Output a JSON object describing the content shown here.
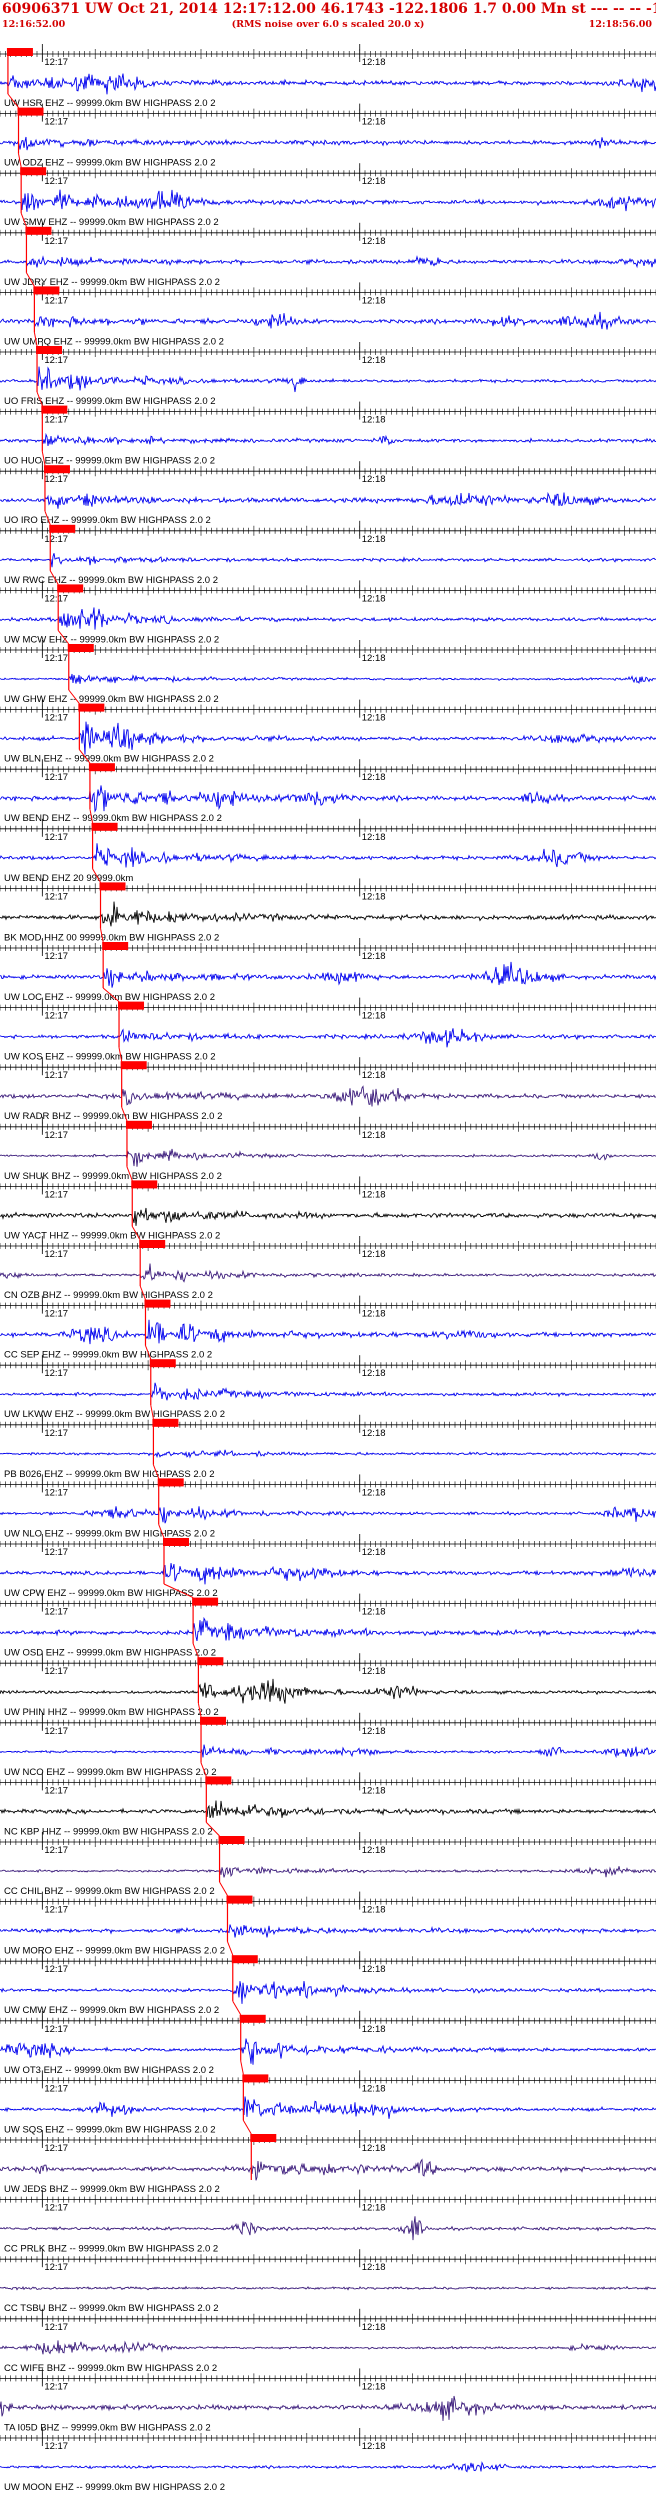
{
  "header": {
    "title": "60906371 UW Oct 21, 2014 12:17:12.00   46.1743 -122.1806  1.7 0.00 Mn st --- -- -- -1",
    "start_time": "12:16:52.00",
    "note": "(RMS noise over 6.0 s scaled 20.0 x)",
    "end_time": "12:18:56.00",
    "color": "#d40000"
  },
  "colors": {
    "blue": "#0000ee",
    "black": "#000000",
    "purple": "#3a1a7a",
    "pick": "#ff0000"
  },
  "chart_data": {
    "type": "line",
    "title": "60906371 UW Oct 21, 2014 12:17:12.00   46.1743 -122.1806  1.7 0.00 Mn st --- -- -- -1",
    "x_range": [
      "12:16:52.00",
      "12:18:56.00"
    ],
    "x_tick_labels": [
      "12:17",
      "12:18"
    ],
    "series": [
      {
        "name": "UW HSR EHZ -- 99999.0km BW  HIGHPASS  2.0  2",
        "color": "blue",
        "pick": "12:16:53.5"
      },
      {
        "name": "UW ODZ EHZ -- 99999.0km BW  HIGHPASS  2.0  2",
        "color": "blue",
        "pick": "12:16:55.5"
      },
      {
        "name": "UW SMW EHZ -- 99999.0km BW  HIGHPASS  2.0  2",
        "color": "blue",
        "pick": "12:16:56.0"
      },
      {
        "name": "UW JDRY EHZ -- 99999.0km BW  HIGHPASS  2.0  2",
        "color": "blue",
        "pick": "12:16:57.0"
      },
      {
        "name": "UW UMPQ EHZ -- 99999.0km BW  HIGHPASS  2.0  2",
        "color": "blue",
        "pick": "12:16:58.5"
      },
      {
        "name": "UO FRIS EHZ -- 99999.0km BW  HIGHPASS  2.0  2",
        "color": "blue",
        "pick": "12:16:59.0"
      },
      {
        "name": "UO HUO EHZ -- 99999.0km BW  HIGHPASS  2.0  2",
        "color": "blue",
        "pick": "12:17:00.0"
      },
      {
        "name": "UO IRO EHZ -- 99999.0km BW  HIGHPASS  2.0  2",
        "color": "blue",
        "pick": "12:17:00.5"
      },
      {
        "name": "UW RWC EHZ -- 99999.0km BW  HIGHPASS  2.0  2",
        "color": "blue",
        "pick": "12:17:01.5"
      },
      {
        "name": "UW MCW EHZ -- 99999.0km BW  HIGHPASS  2.0  2",
        "color": "blue",
        "pick": "12:17:03.0"
      },
      {
        "name": "UW GHW EHZ -- 99999.0km BW  HIGHPASS  2.0  2",
        "color": "blue",
        "pick": "12:17:05.0"
      },
      {
        "name": "UW BLN EHZ -- 99999.0km BW  HIGHPASS  2.0  2",
        "color": "blue",
        "pick": "12:17:07.0"
      },
      {
        "name": "UW BEND EHZ -- 99999.0km BW  HIGHPASS  2.0  2",
        "color": "blue",
        "pick": "12:17:09.0"
      },
      {
        "name": "UW BEND EHZ 20 99999.0km",
        "color": "blue",
        "pick": "12:17:09.5"
      },
      {
        "name": "BK MOD HHZ 00 99999.0km BW  HIGHPASS  2.0  2",
        "color": "black",
        "pick": "12:17:11.0"
      },
      {
        "name": "UW LOC EHZ -- 99999.0km BW  HIGHPASS  2.0  2",
        "color": "blue",
        "pick": "12:17:11.5"
      },
      {
        "name": "UW KOS EHZ -- 99999.0km BW  HIGHPASS  2.0  2",
        "color": "blue",
        "pick": "12:17:14.5"
      },
      {
        "name": "UW RADR BHZ -- 99999.0km BW  HIGHPASS  2.0  2",
        "color": "purple",
        "pick": "12:17:15.0"
      },
      {
        "name": "UW SHUK BHZ -- 99999.0km BW  HIGHPASS  2.0  2",
        "color": "purple",
        "pick": "12:17:16.0"
      },
      {
        "name": "UW YACT HHZ -- 99999.0km BW  HIGHPASS  2.0  2",
        "color": "black",
        "pick": "12:17:17.0"
      },
      {
        "name": "CN OZB BHZ -- 99999.0km BW  HIGHPASS  2.0  2",
        "color": "purple",
        "pick": "12:17:18.5"
      },
      {
        "name": "CC SEP EHZ -- 99999.0km BW  HIGHPASS  2.0  2",
        "color": "blue",
        "pick": "12:17:19.5"
      },
      {
        "name": "UW LKWW EHZ -- 99999.0km BW  HIGHPASS  2.0  2",
        "color": "blue",
        "pick": "12:17:20.5"
      },
      {
        "name": "PB B026 EHZ -- 99999.0km BW  HIGHPASS  2.0  2",
        "color": "blue",
        "pick": "12:17:21.0"
      },
      {
        "name": "UW NLO EHZ -- 99999.0km BW  HIGHPASS  2.0  2",
        "color": "blue",
        "pick": "12:17:22.0"
      },
      {
        "name": "UW CPW EHZ -- 99999.0km BW  HIGHPASS  2.0  2",
        "color": "blue",
        "pick": "12:17:23.0"
      },
      {
        "name": "UW OSD EHZ -- 99999.0km BW  HIGHPASS  2.0  2",
        "color": "blue",
        "pick": "12:17:28.5"
      },
      {
        "name": "UW PHIN HHZ -- 99999.0km BW  HIGHPASS  2.0  2",
        "color": "black",
        "pick": "12:17:29.5"
      },
      {
        "name": "UW NCO EHZ -- 99999.0km BW  HIGHPASS  2.0  2",
        "color": "blue",
        "pick": "12:17:30.0"
      },
      {
        "name": "NC KBP HHZ -- 99999.0km BW  HIGHPASS  2.0  2",
        "color": "black",
        "pick": "12:17:31.0"
      },
      {
        "name": "CC CHIL BHZ -- 99999.0km BW  HIGHPASS  2.0  2",
        "color": "purple",
        "pick": "12:17:33.5"
      },
      {
        "name": "UW MORO EHZ -- 99999.0km BW  HIGHPASS  2.0  2",
        "color": "blue",
        "pick": "12:17:35.0"
      },
      {
        "name": "UW CMW EHZ -- 99999.0km BW  HIGHPASS  2.0  2",
        "color": "blue",
        "pick": "12:17:36.0"
      },
      {
        "name": "UW OT3 EHZ -- 99999.0km BW  HIGHPASS  2.0  2",
        "color": "blue",
        "pick": "12:17:37.5"
      },
      {
        "name": "UW SQS EHZ -- 99999.0km BW  HIGHPASS  2.0  2",
        "color": "blue",
        "pick": "12:17:38.0"
      },
      {
        "name": "UW JEDS BHZ -- 99999.0km BW  HIGHPASS  2.0  2",
        "color": "purple",
        "pick": "12:17:39.5"
      },
      {
        "name": "CC PRLK BHZ -- 99999.0km BW  HIGHPASS  2.0  2",
        "color": "purple",
        "pick": null
      },
      {
        "name": "CC TSBU BHZ -- 99999.0km BW  HIGHPASS  2.0  2",
        "color": "purple",
        "pick": null
      },
      {
        "name": "CC WIFE BHZ -- 99999.0km BW  HIGHPASS  2.0  2",
        "color": "purple",
        "pick": null
      },
      {
        "name": "TA I05D BHZ -- 99999.0km BW  HIGHPASS  2.0  2",
        "color": "purple",
        "pick": null
      },
      {
        "name": "UW MOON EHZ -- 99999.0km BW  HIGHPASS  2.0  2",
        "color": "blue",
        "pick": null
      }
    ],
    "grid": "minor ticks every second on each trace baseline",
    "legend": "none"
  }
}
